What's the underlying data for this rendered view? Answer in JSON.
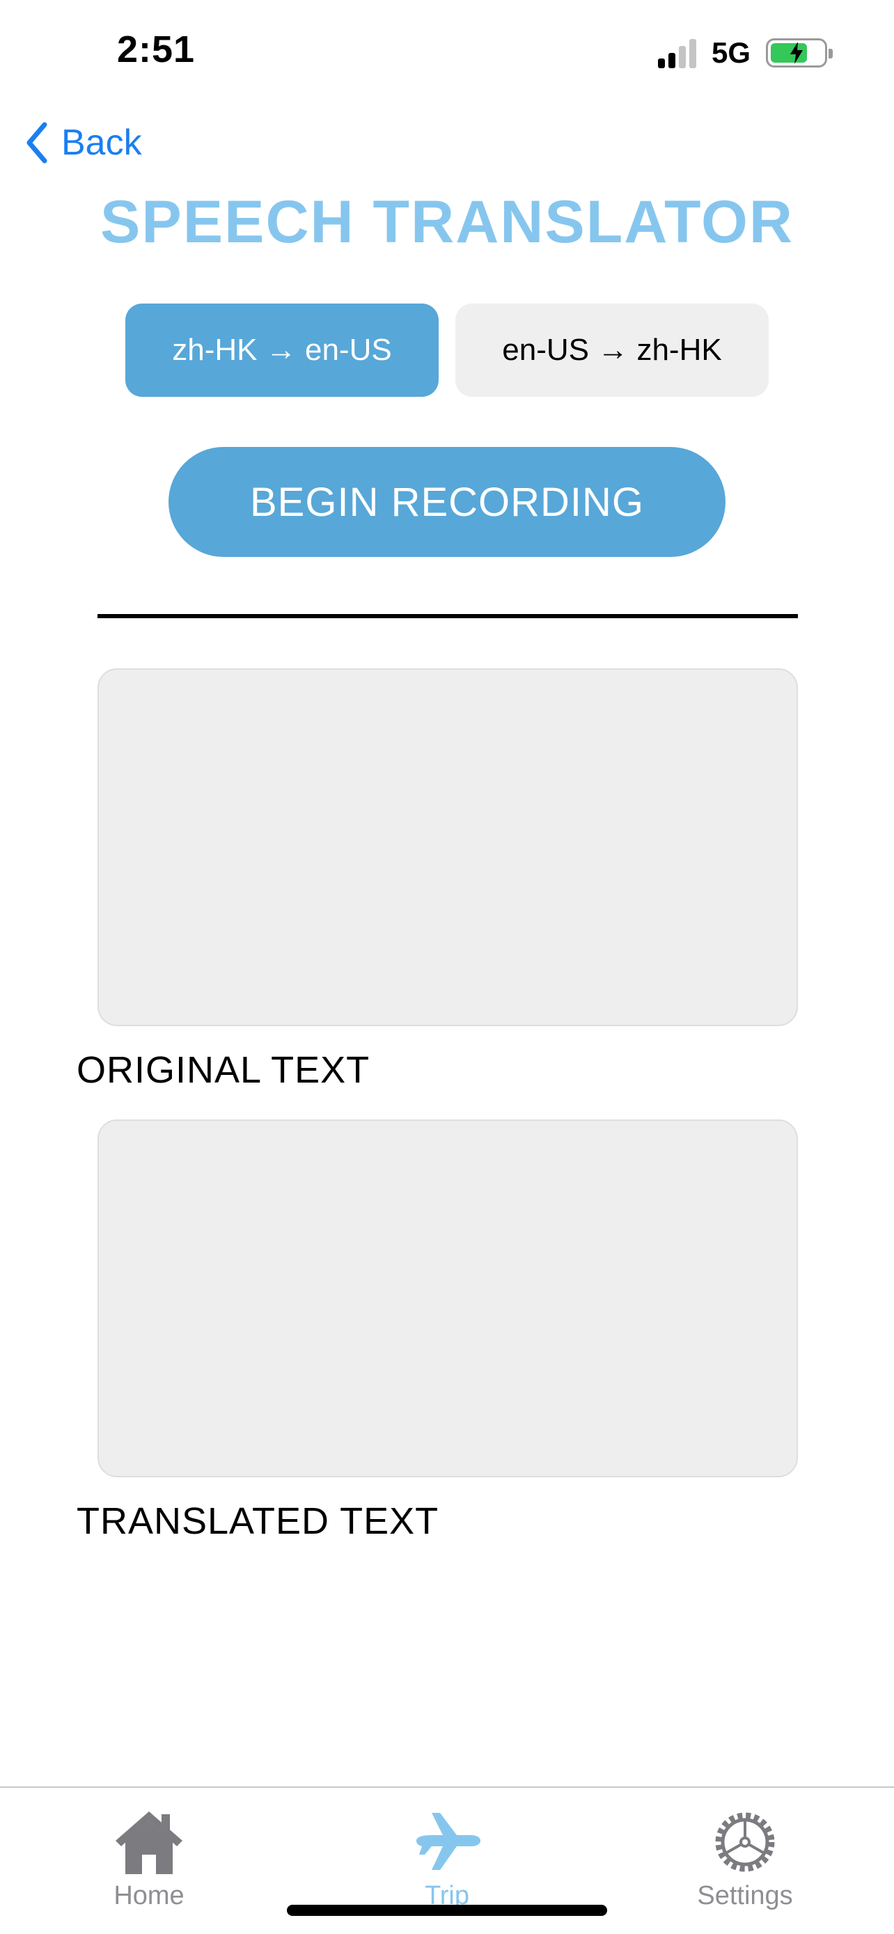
{
  "status_bar": {
    "time": "2:51",
    "network": "5G"
  },
  "nav": {
    "back_label": "Back"
  },
  "title": "SPEECH TRANSLATOR",
  "language_options": [
    {
      "label": "zh-HK → en-US",
      "selected": true
    },
    {
      "label": "en-US → zh-HK",
      "selected": false
    }
  ],
  "record_button": {
    "label": "BEGIN RECORDING"
  },
  "original": {
    "label": "ORIGINAL TEXT",
    "value": ""
  },
  "translated": {
    "label": "TRANSLATED TEXT",
    "value": ""
  },
  "tabs": [
    {
      "label": "Home",
      "icon": "home-icon",
      "active": false
    },
    {
      "label": "Trip",
      "icon": "airplane-icon",
      "active": true
    },
    {
      "label": "Settings",
      "icon": "gear-icon",
      "active": false
    }
  ],
  "colors": {
    "accent": "#57a7d8",
    "title": "#86c6ee",
    "link": "#1a7ff0",
    "battery": "#34c759"
  }
}
